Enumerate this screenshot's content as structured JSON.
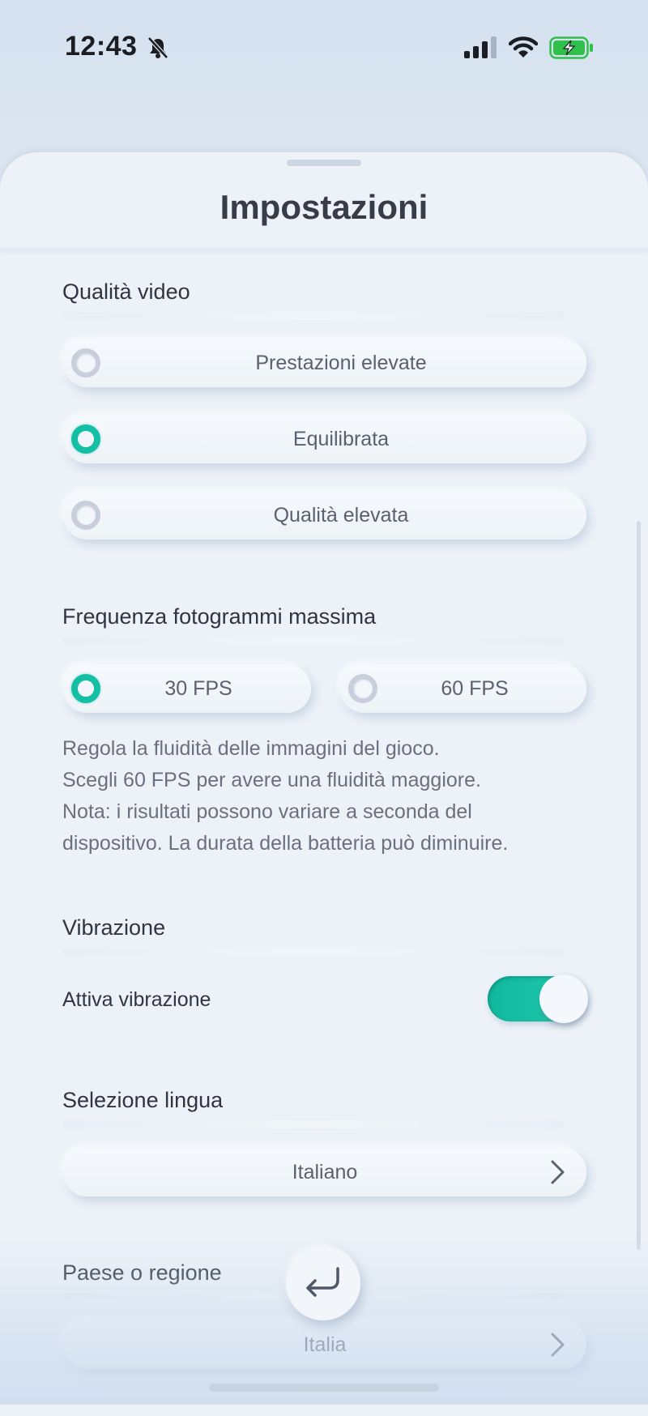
{
  "status_bar": {
    "time": "12:43",
    "icons": [
      "bell-slash-icon",
      "signal-icon",
      "wifi-icon",
      "battery-charging-icon"
    ],
    "battery_color": "#2fbf4a"
  },
  "sheet": {
    "title": "Impostazioni"
  },
  "video_quality": {
    "title": "Qualità video",
    "options": [
      {
        "label": "Prestazioni elevate",
        "selected": false
      },
      {
        "label": "Equilibrata",
        "selected": true
      },
      {
        "label": "Qualità elevata",
        "selected": false
      }
    ]
  },
  "frame_rate": {
    "title": "Frequenza fotogrammi massima",
    "options": [
      {
        "label": "30 FPS",
        "selected": true
      },
      {
        "label": "60 FPS",
        "selected": false
      }
    ],
    "description": [
      "Regola la fluidità delle immagini del gioco.",
      "Scegli 60 FPS per avere una fluidità maggiore.",
      "Nota: i risultati possono variare a seconda del",
      "dispositivo. La durata della batteria può diminuire."
    ]
  },
  "vibration": {
    "title": "Vibrazione",
    "toggle_label": "Attiva vibrazione",
    "enabled": true
  },
  "language": {
    "title": "Selezione lingua",
    "value": "Italiano"
  },
  "region": {
    "title": "Paese o regione",
    "value": "Italia"
  },
  "colors": {
    "accent": "#15bfa6",
    "background": "#edf2f8",
    "text": "#2f3542"
  }
}
